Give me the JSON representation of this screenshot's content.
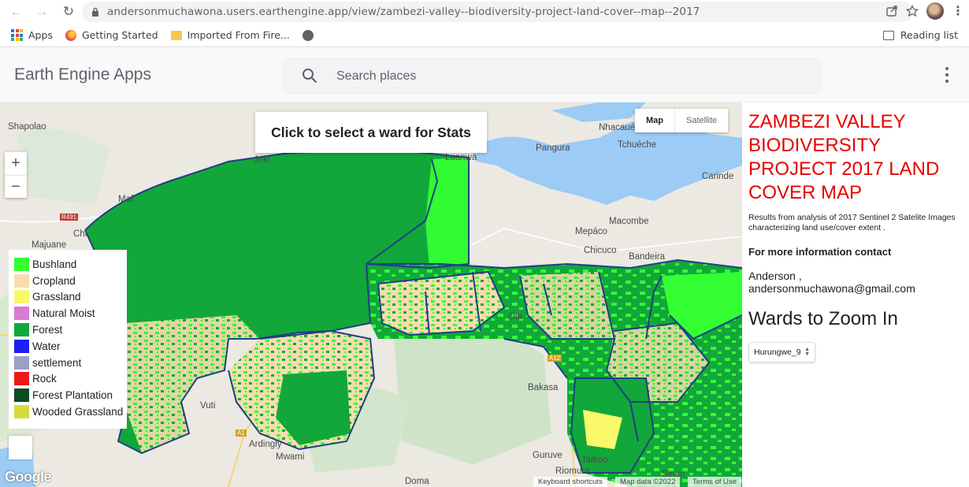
{
  "browser": {
    "url": "andersonmuchawona.users.earthengine.app/view/zambezi-valley--biodiversity-project-land-cover--map--2017",
    "bookmarks": [
      {
        "label": "Apps",
        "icon": "apps-grid-icon"
      },
      {
        "label": "Getting Started",
        "icon": "firefox-icon"
      },
      {
        "label": "Imported From Fire...",
        "icon": "folder-icon"
      }
    ],
    "reading_list": "Reading list"
  },
  "header": {
    "app_name": "Earth Engine Apps",
    "search_placeholder": "Search places"
  },
  "map": {
    "select_prompt": "Click to select a ward for Stats",
    "map_type": {
      "map": "Map",
      "satellite": "Satellite"
    },
    "zoom_in": "+",
    "zoom_out": "−",
    "places": [
      "Shapolao",
      "Nhacaué",
      "Pangura",
      "Tchuéche",
      "Carinde",
      "Jeki",
      "Luanwa",
      "Maf",
      "Chi",
      "Majuane",
      "Macombe",
      "Mepáco",
      "Chicuco",
      "Bandeira",
      "Bakasa",
      "Vuti",
      "Ardingly",
      "Mwami",
      "Guruve",
      "Taikoo",
      "Riomura",
      "Doma",
      "Ola",
      "Sinari"
    ],
    "roads": [
      "R491",
      "A12",
      "A1"
    ],
    "logo": "Google",
    "attribution": {
      "shortcuts": "Keyboard shortcuts",
      "data": "Map data ©2022",
      "terms": "Terms of Use"
    }
  },
  "legend": [
    {
      "label": "Bushland",
      "color": "#33ff33"
    },
    {
      "label": "Cropland",
      "color": "#f8dcb0"
    },
    {
      "label": "Grassland",
      "color": "#f8f86a"
    },
    {
      "label": "Natural Moist",
      "color": "#d77ad6"
    },
    {
      "label": "Forest",
      "color": "#12a73a"
    },
    {
      "label": "Water",
      "color": "#1e1ef5"
    },
    {
      "label": "settlement",
      "color": "#9ba0c6"
    },
    {
      "label": "Rock",
      "color": "#f01616"
    },
    {
      "label": "Forest Plantation",
      "color": "#0b4a23"
    },
    {
      "label": "Wooded Grassland",
      "color": "#d6dc3b"
    }
  ],
  "panel": {
    "title": "ZAMBEZI VALLEY BIODIVERSITY PROJECT 2017 LAND COVER MAP",
    "description": "Results from analysis of 2017 Sentinel 2 Satelite Images characterizing land use/cover extent .",
    "contact_heading": "For more information contact",
    "author": "Anderson , andersonmuchawona@gmail.com",
    "wards_heading": "Wards to Zoom In",
    "ward_selected": "Hurungwe_9"
  }
}
